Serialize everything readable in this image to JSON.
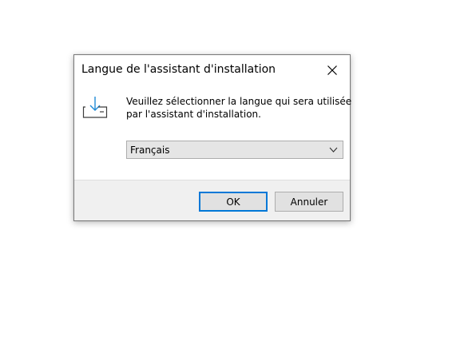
{
  "dialog": {
    "title": "Langue de l'assistant d'installation",
    "close_icon": "close-icon",
    "setup_icon": "download-install-icon",
    "message_line1": "Veuillez sélectionner la langue qui sera utilisée",
    "message_line2": "par l'assistant d'installation.",
    "language_select": {
      "selected": "Français"
    },
    "buttons": {
      "ok_label": "OK",
      "cancel_label": "Annuler"
    },
    "colors": {
      "accent": "#0078d7",
      "footer_bg": "#f0f0f0",
      "select_bg": "#e5e5e5"
    }
  }
}
